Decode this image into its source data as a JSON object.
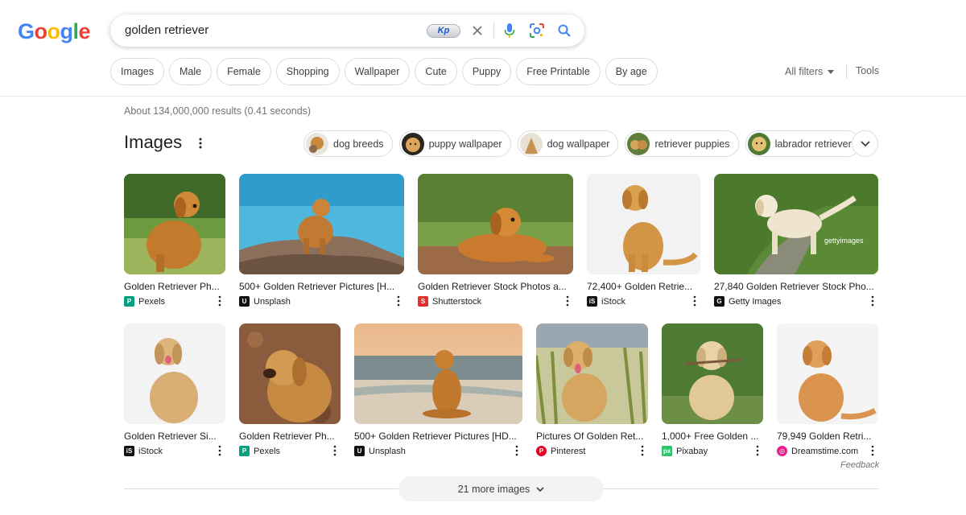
{
  "logo": {
    "letters": [
      "G",
      "o",
      "o",
      "g",
      "l",
      "e"
    ],
    "colors": [
      "#4285F4",
      "#EA4335",
      "#FBBC05",
      "#4285F4",
      "#34A853",
      "#EA4335"
    ]
  },
  "search": {
    "value": "golden retriever",
    "extension_badge": "Kp"
  },
  "icons": {
    "clear": "close-icon",
    "mic": "microphone-icon",
    "lens": "google-lens-icon",
    "search": "search-icon"
  },
  "chips": [
    "Images",
    "Male",
    "Female",
    "Shopping",
    "Wallpaper",
    "Cute",
    "Puppy",
    "Free Printable",
    "By age"
  ],
  "filters": {
    "all_filters": "All filters",
    "tools": "Tools"
  },
  "stats": "About 134,000,000 results (0.41 seconds)",
  "images_section": {
    "title": "Images",
    "related": [
      "dog breeds",
      "puppy wallpaper",
      "dog wallpaper",
      "retriever puppies",
      "labrador retriever"
    ],
    "row1": [
      {
        "caption": "Golden Retriever Ph...",
        "source": "Pexels",
        "fav": "P",
        "fav_color": "#05a081"
      },
      {
        "caption": "500+ Golden Retriever Pictures [H...",
        "source": "Unsplash",
        "fav": "U",
        "fav_color": "#111111"
      },
      {
        "caption": "Golden Retriever Stock Photos a...",
        "source": "Shutterstock",
        "fav": "S",
        "fav_color": "#e0312f"
      },
      {
        "caption": "72,400+ Golden Retrie...",
        "source": "iStock",
        "fav": "iS",
        "fav_color": "#111111"
      },
      {
        "caption": "27,840 Golden Retriever Stock Pho...",
        "source": "Getty Images",
        "fav": "G",
        "fav_color": "#111111"
      }
    ],
    "row2": [
      {
        "caption": "Golden Retriever Si...",
        "source": "iStock",
        "fav": "iS",
        "fav_color": "#111111"
      },
      {
        "caption": "Golden Retriever Ph...",
        "source": "Pexels",
        "fav": "P",
        "fav_color": "#05a081"
      },
      {
        "caption": "500+ Golden Retriever Pictures [HD...",
        "source": "Unsplash",
        "fav": "U",
        "fav_color": "#111111"
      },
      {
        "caption": "Pictures Of Golden Ret...",
        "source": "Pinterest",
        "fav": "P",
        "fav_color": "#e60023"
      },
      {
        "caption": "1,000+ Free Golden ...",
        "source": "Pixabay",
        "fav": "px",
        "fav_color": "#2ec66d"
      },
      {
        "caption": "79,949 Golden Retri...",
        "source": "Dreamstime.com",
        "fav": "◎",
        "fav_color": "#e91e8c"
      }
    ],
    "watermark": "gettyimages"
  },
  "feedback": "Feedback",
  "more_images": "21 more images"
}
